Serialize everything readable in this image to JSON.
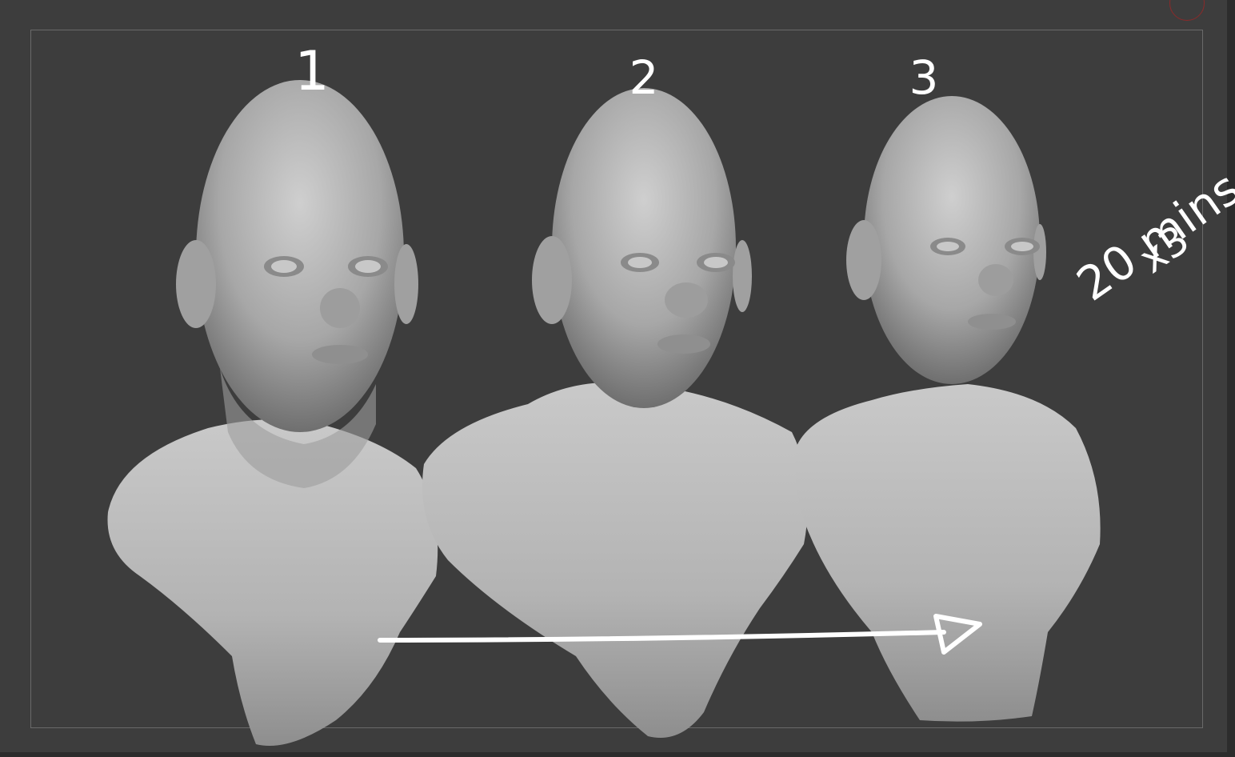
{
  "canvas": {
    "background": "#3d3d3d",
    "frame_color": "#6a6a6a",
    "model_color": "#bdbdbd"
  },
  "busts": [
    {
      "number": "1"
    },
    {
      "number": "2"
    },
    {
      "number": "3"
    }
  ],
  "annotation": {
    "time_label": "20 mins",
    "multiplier_label": "x3",
    "arrow": "progression-arrow"
  },
  "icons": {
    "corner": "circle-indicator-icon"
  }
}
